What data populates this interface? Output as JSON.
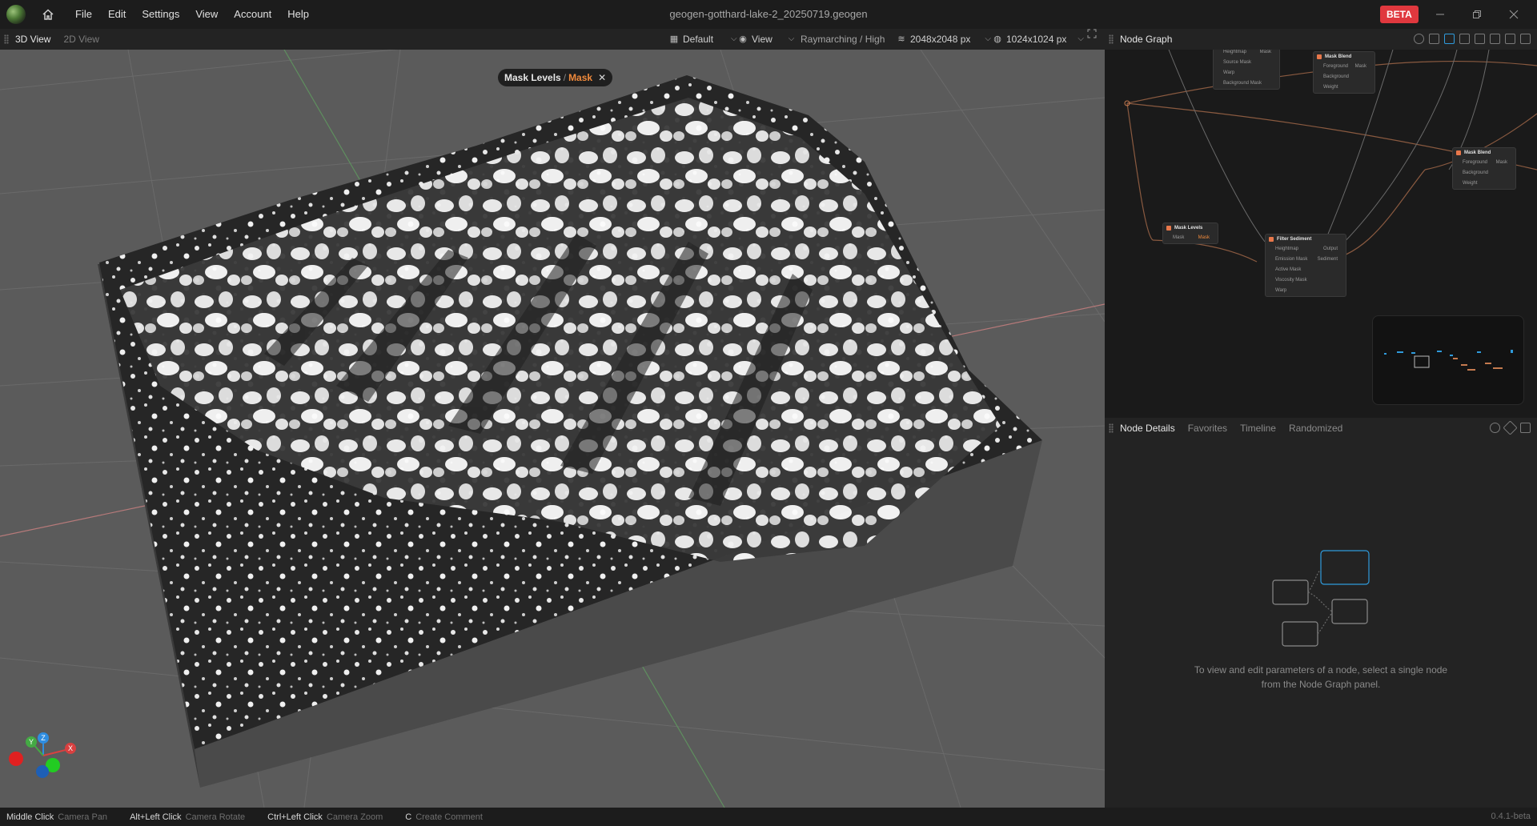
{
  "app": {
    "window_title": "geogen-gotthard-lake-2_20250719.geogen",
    "badge": "BETA",
    "version": "0.4.1-beta"
  },
  "menu": [
    {
      "label": "File"
    },
    {
      "label": "Edit"
    },
    {
      "label": "Settings"
    },
    {
      "label": "View"
    },
    {
      "label": "Account"
    },
    {
      "label": "Help"
    }
  ],
  "viewport_toolbar": {
    "tabs": [
      {
        "label": "3D View",
        "active": true
      },
      {
        "label": "2D View",
        "active": false
      }
    ],
    "preset": "Default",
    "view_menu": "View",
    "render_mode": "Raymarching / High",
    "resolution": "2048x2048 px",
    "world_size": "1024x1024 px"
  },
  "breadcrumb": {
    "parent": "Mask Levels",
    "separator": "/",
    "current": "Mask"
  },
  "node_graph": {
    "title": "Node Graph",
    "nodes": [
      {
        "title": "",
        "params": [
          [
            "Heightmap",
            "Mask"
          ],
          [
            "Source Mask",
            ""
          ],
          [
            "Warp",
            ""
          ],
          [
            "Background Mask",
            ""
          ]
        ]
      },
      {
        "title": "Mask Blend",
        "params": [
          [
            "Foreground",
            "Mask"
          ],
          [
            "Background",
            ""
          ],
          [
            "Weight",
            ""
          ]
        ]
      },
      {
        "title": "Mask Blend",
        "params": [
          [
            "Foreground",
            "Mask"
          ],
          [
            "Background",
            ""
          ],
          [
            "Weight",
            ""
          ]
        ]
      },
      {
        "title": "Mask Levels",
        "params": [
          [
            "Mask",
            "Mask"
          ]
        ]
      },
      {
        "title": "Filter Sediment",
        "params": [
          [
            "Heightmap",
            "Output"
          ],
          [
            "Emission Mask",
            "Sediment"
          ],
          [
            "Active Mask",
            ""
          ],
          [
            "Viscosity Mask",
            ""
          ],
          [
            "Warp",
            ""
          ]
        ]
      }
    ]
  },
  "node_details": {
    "tabs": [
      {
        "label": "Node Details",
        "active": true
      },
      {
        "label": "Favorites",
        "active": false
      },
      {
        "label": "Timeline",
        "active": false
      },
      {
        "label": "Randomized",
        "active": false
      }
    ],
    "empty_message": "To view and edit parameters of a node, select a single node from the Node Graph panel."
  },
  "status_hints": [
    {
      "key": "Middle Click",
      "action": "Camera Pan"
    },
    {
      "key": "Alt+Left Click",
      "action": "Camera Rotate"
    },
    {
      "key": "Ctrl+Left Click",
      "action": "Camera Zoom"
    },
    {
      "key": "C",
      "action": "Create Comment"
    }
  ],
  "gizmo": {
    "x": "X",
    "y": "Y",
    "z": "Z"
  },
  "colors": {
    "accent_orange": "#f08a3c",
    "beta_red": "#e0383e",
    "selection_blue": "#2f9bdc"
  }
}
